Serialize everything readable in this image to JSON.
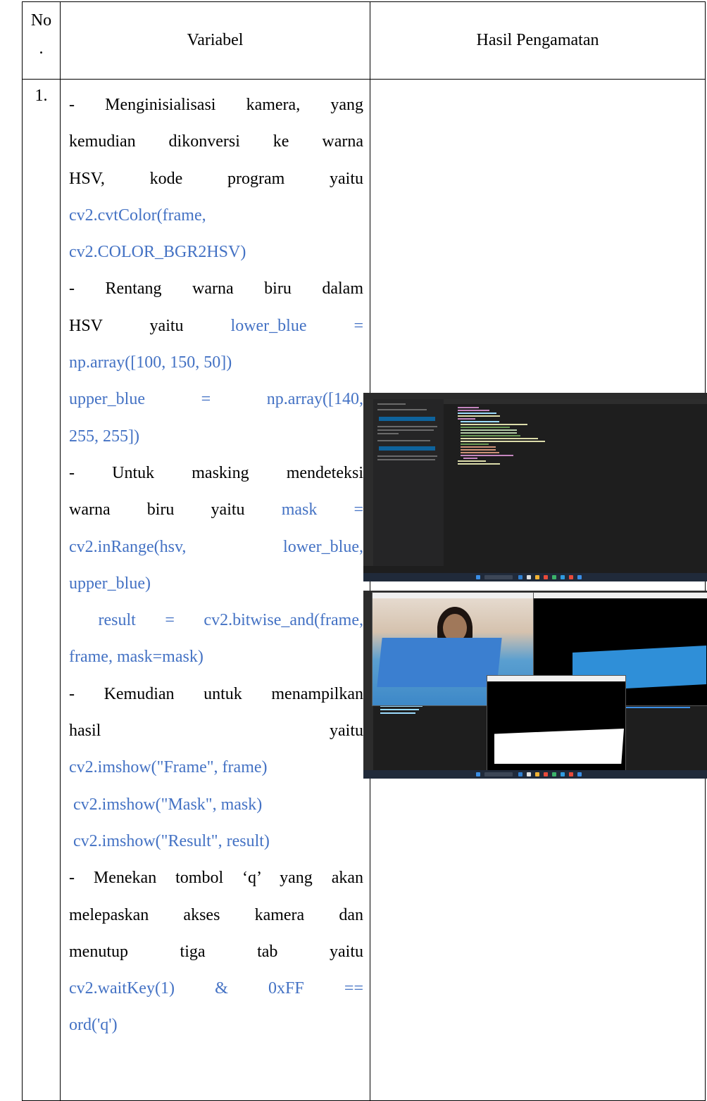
{
  "table": {
    "headers": {
      "no": "No",
      "no_dot": ".",
      "variabel": "Variabel",
      "hasil": "Hasil Pengamatan"
    },
    "row": {
      "no": "1.",
      "lines": [
        {
          "text": "- Menginisialisasi kamera, yang",
          "style": "j",
          "code": false
        },
        {
          "text": "kemudian dikonversi ke warna",
          "style": "j",
          "code": false
        },
        {
          "text": "HSV, kode program yaitu",
          "style": "j",
          "code": false
        },
        {
          "text": "cv2.cvtColor(frame,",
          "style": "l",
          "code": true
        },
        {
          "text": "cv2.COLOR_BGR2HSV)",
          "style": "l",
          "code": true
        },
        {
          "text": "- Rentang warna biru dalam",
          "style": "j",
          "code": false
        },
        {
          "text": "HSV yaitu lower_blue =",
          "style": "mixed1",
          "code": false
        },
        {
          "text": "np.array([100, 150, 50])",
          "style": "l",
          "code": true
        },
        {
          "text": "upper_blue = np.array([140,",
          "style": "j",
          "code": true
        },
        {
          "text": "255, 255])",
          "style": "l",
          "code": true
        },
        {
          "text": "- Untuk masking mendeteksi",
          "style": "j",
          "code": false
        },
        {
          "text": "warna biru yaitu mask =",
          "style": "mixed2",
          "code": false
        },
        {
          "text": "cv2.inRange(hsv, lower_blue,",
          "style": "j",
          "code": true
        },
        {
          "text": "upper_blue)",
          "style": "l",
          "code": true
        },
        {
          "text": " result = cv2.bitwise_and(frame,",
          "style": "j",
          "code": true
        },
        {
          "text": "frame, mask=mask)",
          "style": "l",
          "code": true
        },
        {
          "text": "- Kemudian untuk menampilkan",
          "style": "j",
          "code": false
        },
        {
          "text": "hasil yaitu",
          "style": "j",
          "code": false
        },
        {
          "text": "cv2.imshow(\"Frame\", frame)",
          "style": "l",
          "code": true
        },
        {
          "text": " cv2.imshow(\"Mask\", mask)",
          "style": "l",
          "code": true
        },
        {
          "text": " cv2.imshow(\"Result\", result)",
          "style": "l",
          "code": true
        },
        {
          "text": "- Menekan tombol ‘q’ yang akan",
          "style": "j",
          "code": false
        },
        {
          "text": "melepaskan akses kamera dan",
          "style": "j",
          "code": false
        },
        {
          "text": "menutup tiga tab yaitu",
          "style": "j",
          "code": false
        },
        {
          "text": "cv2.waitKey(1) & 0xFF ==",
          "style": "j",
          "code": true
        },
        {
          "text": "ord('q')",
          "style": "l",
          "code": true
        }
      ],
      "mixed": {
        "hsv_prefix": "HSV yaitu",
        "lower_blue_code": "lower_blue =",
        "warna_prefix": "warna biru yaitu",
        "mask_code": "mask ="
      }
    }
  },
  "colors": {
    "code": "#4472c4",
    "border": "#000000",
    "vscode_bg": "#1e1e1e",
    "vscode_accent": "#0e639c"
  },
  "screenshots": {
    "first": {
      "kind": "vscode-editor"
    },
    "second": {
      "kind": "camera-windows",
      "window_titles": [
        "Frame",
        "Mask",
        "Result"
      ]
    }
  }
}
